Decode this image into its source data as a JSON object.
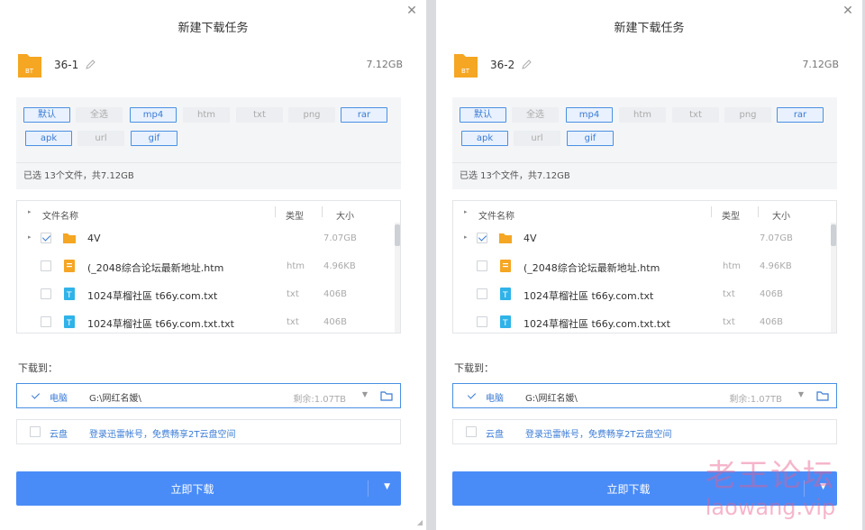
{
  "colors": {
    "accent": "#4a8cf7",
    "folder": "#f5a623",
    "txt_icon": "#2fb3e8",
    "watermark": "#e85a8c"
  },
  "dialogs": [
    {
      "title": "新建下载任务",
      "task_name": "36-1",
      "task_size": "7.12GB",
      "filters": [
        {
          "label": "默认",
          "on": true
        },
        {
          "label": "全选",
          "on": false
        },
        {
          "label": "mp4",
          "on": true
        },
        {
          "label": "htm",
          "on": false
        },
        {
          "label": "txt",
          "on": false
        },
        {
          "label": "png",
          "on": false
        },
        {
          "label": "rar",
          "on": true
        },
        {
          "label": "apk",
          "on": true
        },
        {
          "label": "url",
          "on": false
        },
        {
          "label": "gif",
          "on": true
        }
      ],
      "selection_summary": "已选 13个文件，共7.12GB",
      "columns": {
        "name": "文件名称",
        "type": "类型",
        "size": "大小"
      },
      "files": [
        {
          "name": "4V",
          "type": "",
          "size": "7.07GB",
          "icon": "folder-icon",
          "checked": true
        },
        {
          "name": "(_2048综合论坛最新地址.htm",
          "type": "htm",
          "size": "4.96KB",
          "icon": "htm-file-icon",
          "checked": false
        },
        {
          "name": "1024草榴社區 t66y.com.txt",
          "type": "txt",
          "size": "406B",
          "icon": "txt-file-icon",
          "checked": false
        },
        {
          "name": "1024草榴社區 t66y.com.txt.txt",
          "type": "txt",
          "size": "406B",
          "icon": "txt-file-icon",
          "checked": false
        }
      ],
      "download_to_label": "下载到：",
      "local": {
        "name": "电脑",
        "path": "G:\\网红名媛\\",
        "free": "剩余:1.07TB"
      },
      "cloud": {
        "name": "云盘",
        "text": "登录迅雷帐号，免费畅享2T云盘空间"
      },
      "download_button": "立即下载"
    },
    {
      "title": "新建下载任务",
      "task_name": "36-2",
      "task_size": "7.12GB",
      "filters": [
        {
          "label": "默认",
          "on": true
        },
        {
          "label": "全选",
          "on": false
        },
        {
          "label": "mp4",
          "on": true
        },
        {
          "label": "htm",
          "on": false
        },
        {
          "label": "txt",
          "on": false
        },
        {
          "label": "png",
          "on": false
        },
        {
          "label": "rar",
          "on": true
        },
        {
          "label": "apk",
          "on": true
        },
        {
          "label": "url",
          "on": false
        },
        {
          "label": "gif",
          "on": true
        }
      ],
      "selection_summary": "已选 13个文件，共7.12GB",
      "columns": {
        "name": "文件名称",
        "type": "类型",
        "size": "大小"
      },
      "files": [
        {
          "name": "4V",
          "type": "",
          "size": "7.07GB",
          "icon": "folder-icon",
          "checked": true
        },
        {
          "name": "(_2048综合论坛最新地址.htm",
          "type": "htm",
          "size": "4.96KB",
          "icon": "htm-file-icon",
          "checked": false
        },
        {
          "name": "1024草榴社區 t66y.com.txt",
          "type": "txt",
          "size": "406B",
          "icon": "txt-file-icon",
          "checked": false
        },
        {
          "name": "1024草榴社區 t66y.com.txt.txt",
          "type": "txt",
          "size": "406B",
          "icon": "txt-file-icon",
          "checked": false
        }
      ],
      "download_to_label": "下载到：",
      "local": {
        "name": "电脑",
        "path": "G:\\网红名媛\\",
        "free": "剩余:1.07TB"
      },
      "cloud": {
        "name": "云盘",
        "text": "登录迅雷帐号，免费畅享2T云盘空间"
      },
      "download_button": "立即下载"
    }
  ],
  "watermark": {
    "cn": "老王论坛",
    "en": "laowang.vip"
  }
}
